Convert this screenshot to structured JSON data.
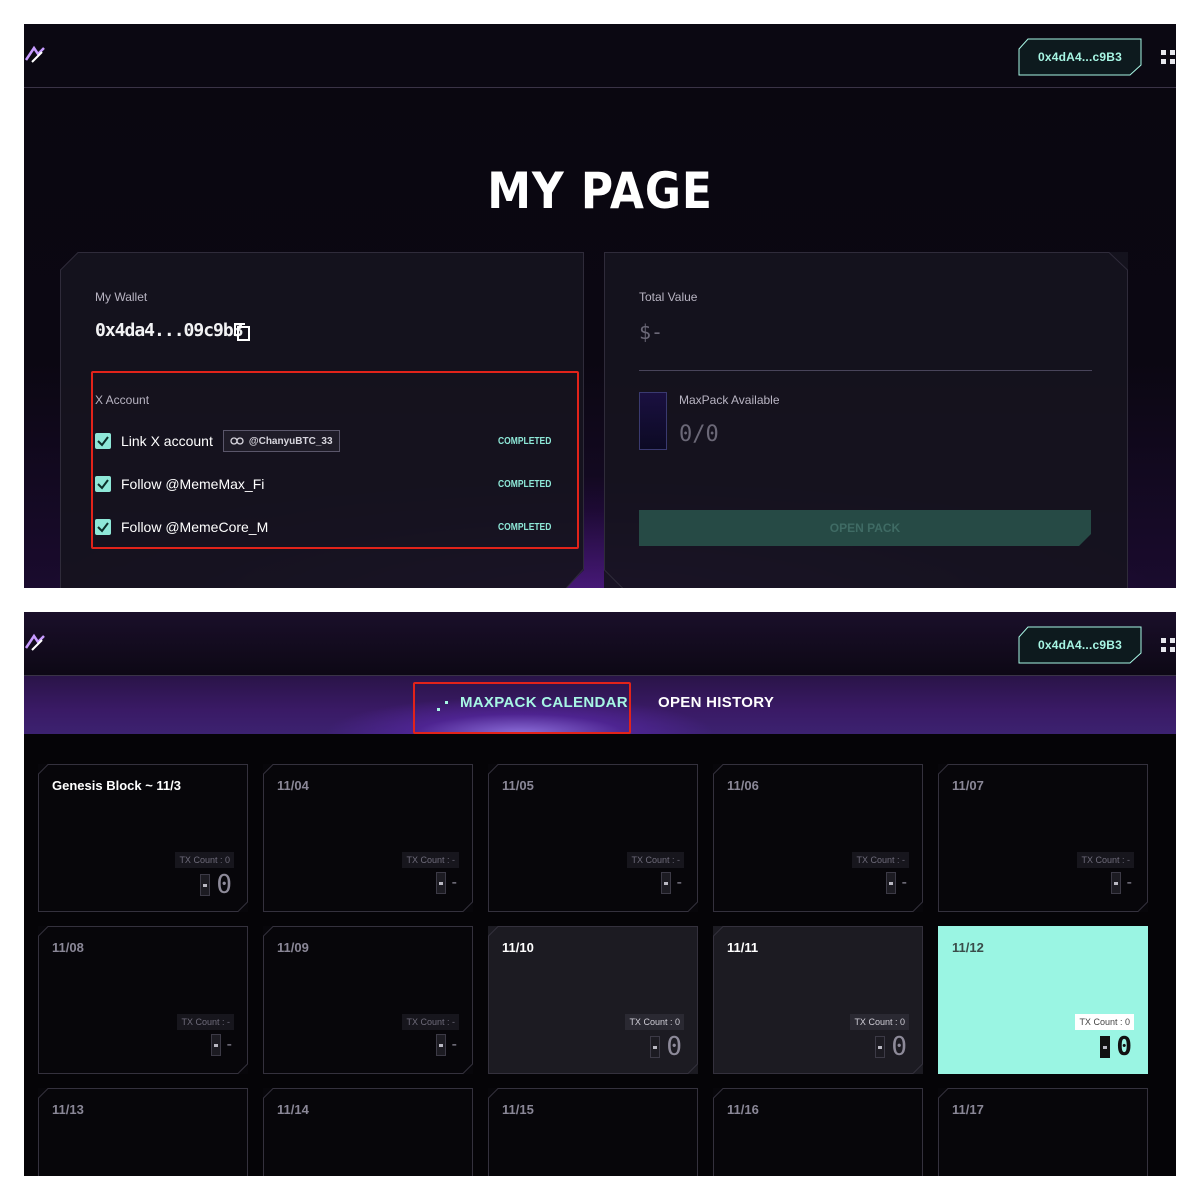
{
  "header": {
    "wallet_button": "0x4dA4...c9B3"
  },
  "my_page": {
    "title": "MY PAGE",
    "wallet_card": {
      "label": "My Wallet",
      "address": "0x4da4...09c9b3",
      "x_account_label": "X Account",
      "tasks": [
        {
          "label": "Link X account",
          "handle": "@ChanyuBTC_33",
          "status": "COMPLETED"
        },
        {
          "label": "Follow @MemeMax_Fi",
          "status": "COMPLETED"
        },
        {
          "label": "Follow @MemeCore_M",
          "status": "COMPLETED"
        }
      ]
    },
    "value_card": {
      "total_value_label": "Total Value",
      "total_value": "$-",
      "maxpack_label": "MaxPack Available",
      "maxpack_value": "0/0",
      "open_pack_button": "OPEN PACK"
    }
  },
  "calendar": {
    "tabs": {
      "calendar": "MAXPACK CALENDAR",
      "history": "OPEN HISTORY"
    },
    "tx_label": "TX Count :",
    "days": [
      {
        "date": "Genesis Block ~ 11/3",
        "tx": "0",
        "count": "0",
        "state": "genesis"
      },
      {
        "date": "11/04",
        "tx": "-",
        "count": "-",
        "state": "empty"
      },
      {
        "date": "11/05",
        "tx": "-",
        "count": "-",
        "state": "empty"
      },
      {
        "date": "11/06",
        "tx": "-",
        "count": "-",
        "state": "empty"
      },
      {
        "date": "11/07",
        "tx": "-",
        "count": "-",
        "state": "empty"
      },
      {
        "date": "11/08",
        "tx": "-",
        "count": "-",
        "state": "empty"
      },
      {
        "date": "11/09",
        "tx": "-",
        "count": "-",
        "state": "empty"
      },
      {
        "date": "11/10",
        "tx": "0",
        "count": "0",
        "state": "active"
      },
      {
        "date": "11/11",
        "tx": "0",
        "count": "0",
        "state": "active"
      },
      {
        "date": "11/12",
        "tx": "0",
        "count": "0",
        "state": "today"
      },
      {
        "date": "11/13",
        "tx": "-",
        "count": "-",
        "state": "empty"
      },
      {
        "date": "11/14",
        "tx": "-",
        "count": "-",
        "state": "empty"
      },
      {
        "date": "11/15",
        "tx": "-",
        "count": "-",
        "state": "empty"
      },
      {
        "date": "11/16",
        "tx": "-",
        "count": "-",
        "state": "empty"
      },
      {
        "date": "11/17",
        "tx": "-",
        "count": "-",
        "state": "empty"
      }
    ]
  },
  "colors": {
    "accent": "#a7f6e4",
    "highlight_box": "#e2231a",
    "today_cell": "#9af5e3"
  }
}
